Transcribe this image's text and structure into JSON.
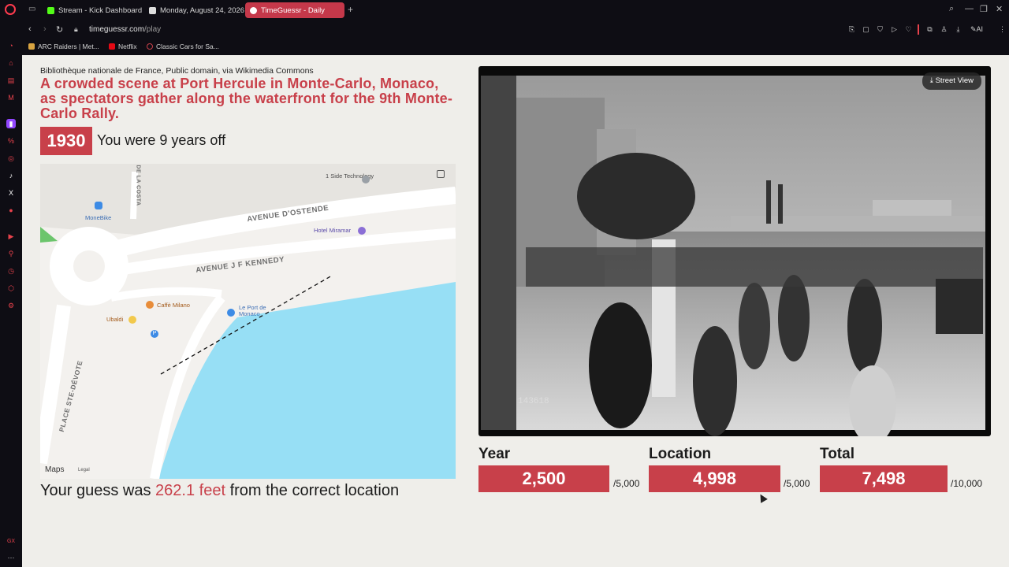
{
  "browser": {
    "tabs": [
      {
        "label": "Stream - Kick Dashboard",
        "favicon_color": "#53fc18"
      },
      {
        "label": "Monday, August 24, 2026",
        "favicon_color": "#ffffff"
      },
      {
        "label": "TimeGuessr - Daily",
        "favicon_color": "#ffffff",
        "active": true
      }
    ],
    "url_domain": "timeguessr.com",
    "url_path": "/play",
    "bookmarks": [
      {
        "label": "ARC Raiders | Met...",
        "favicon_color": "#d9a441"
      },
      {
        "label": "Netflix",
        "favicon_color": "#e50914"
      },
      {
        "label": "Classic Cars for Sa...",
        "favicon_color": "#c8404a"
      }
    ],
    "sidebar_label": "GX",
    "accent_color": "#ff3b4e"
  },
  "result": {
    "credit": "Bibliothèque nationale de France, Public domain, via Wikimedia Commons",
    "description": "A crowded scene at Port Hercule in Monte-Carlo, Monaco, as spectators gather along the waterfront for the 9th Monte-Carlo Rally.",
    "year": "1930",
    "year_off_text": "You were 9 years off",
    "guess_prefix": "Your guess was",
    "guess_distance": "262.1 feet",
    "guess_suffix": "from the correct location",
    "accent_color": "#c8404a"
  },
  "map": {
    "labels": {
      "side_tech": "1 Side Technology",
      "monebike": "MoneBike",
      "avenue_ostende": "AVENUE D'OSTENDE",
      "hotel_miramar": "Hotel Miramar",
      "avenue_kennedy": "AVENUE J F KENNEDY",
      "caffe_milano": "Caffè Milano",
      "le_port": "Le Port de Monaco",
      "ubaldi": "Ubaldi",
      "place_ste_devote": "PLACE STE-DÉVOTE",
      "de_la_costa": "DE LA COSTA"
    },
    "maps_brand": "Maps",
    "legal": "Legal",
    "water_color": "#97dff5"
  },
  "photo": {
    "street_view_label": "Street View",
    "negative_number": "143618"
  },
  "scores": {
    "year_label": "Year",
    "year_value": "2,500",
    "year_max": "/5,000",
    "location_label": "Location",
    "location_value": "4,998",
    "location_max": "/5,000",
    "total_label": "Total",
    "total_value": "7,498",
    "total_max": "/10,000"
  }
}
